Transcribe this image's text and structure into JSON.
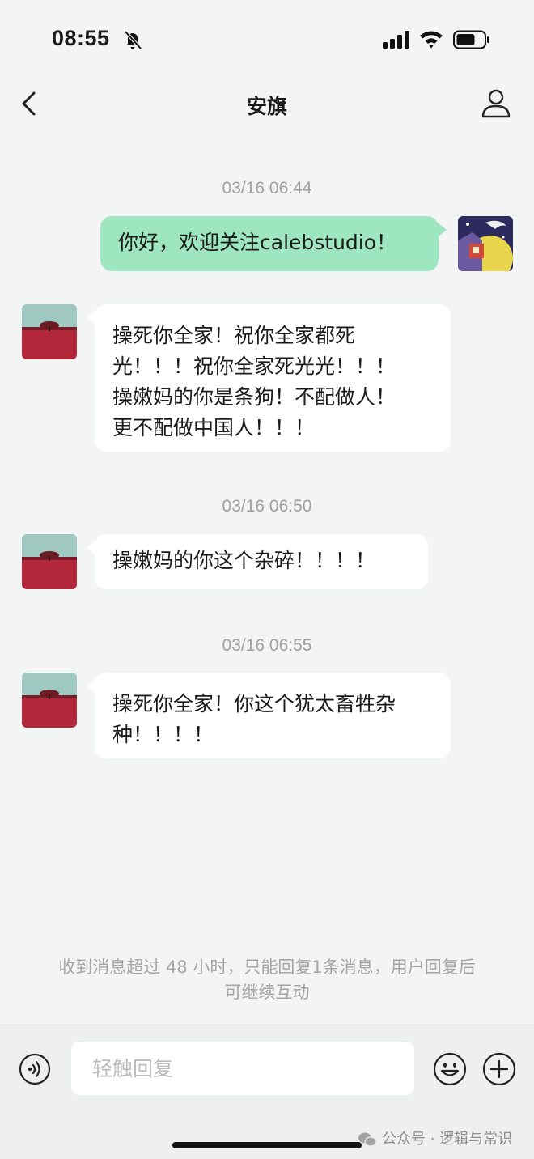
{
  "status_bar": {
    "time": "08:55",
    "icons": [
      "bell-slash-icon",
      "signal-icon",
      "wifi-icon",
      "battery-icon"
    ]
  },
  "header": {
    "title": "安旗",
    "back_icon": "chevron-left-icon",
    "profile_icon": "person-outline-icon"
  },
  "messages": [
    {
      "timestamp": "03/16 06:44"
    },
    {
      "direction": "out",
      "text": "你好，欢迎关注calebstudio！"
    },
    {
      "direction": "in",
      "lines": [
        "操死你全家！祝你全家都死",
        "光！！！祝你全家死光光！！！",
        "操嫩妈的你是条狗！不配做人！",
        "更不配做中国人！！！"
      ]
    },
    {
      "timestamp": "03/16 06:50"
    },
    {
      "direction": "in",
      "text": "操嫩妈的你这个杂碎！！！！"
    },
    {
      "timestamp": "03/16 06:55"
    },
    {
      "direction": "in",
      "lines": [
        "操死你全家！你这个犹太畜牲杂",
        "种！！！！"
      ]
    }
  ],
  "notice": {
    "line1": "收到消息超过 48 小时，只能回复1条消息，用户回复后",
    "line2": "可继续互动"
  },
  "input_bar": {
    "placeholder": "轻触回复",
    "icons": [
      "voice-icon",
      "emoji-icon",
      "plus-icon"
    ]
  },
  "watermark": "公众号 · 逻辑与常识",
  "colors": {
    "background": "#f3f4f4",
    "outgoing_bubble": "#9ee6bf",
    "incoming_bubble": "#ffffff",
    "timestamp_text": "#9ea1a1"
  }
}
